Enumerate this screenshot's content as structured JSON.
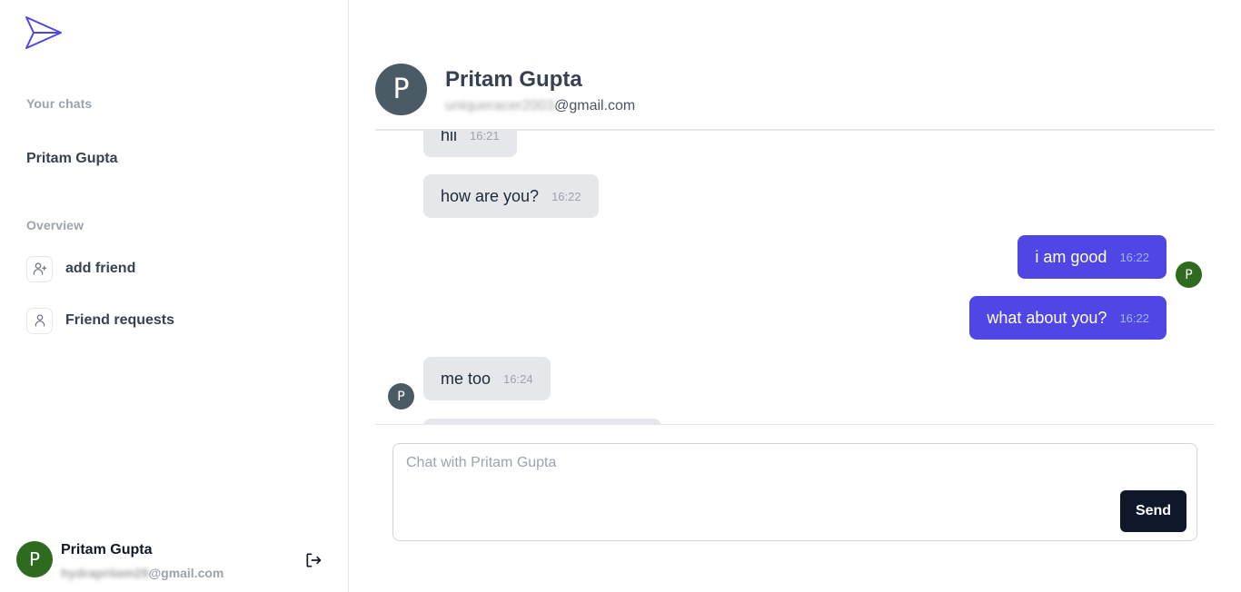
{
  "app": {
    "logo_icon": "paper-plane-icon",
    "accent_color": "#4f46e5"
  },
  "sidebar": {
    "chats_label": "Your chats",
    "chats": [
      {
        "name": "Pritam Gupta"
      }
    ],
    "overview_label": "Overview",
    "overview_items": [
      {
        "label": "add friend",
        "icon": "user-plus-icon"
      },
      {
        "label": "Friend requests",
        "icon": "user-icon"
      }
    ],
    "profile": {
      "initial": "P",
      "name": "Pritam Gupta",
      "email_hidden": "hydrapritam29",
      "email_domain": "@gmail.com",
      "avatar_color": "#2f6b1f",
      "logout_icon": "sign-out-icon"
    }
  },
  "chat": {
    "partner": {
      "initial": "P",
      "name": "Pritam Gupta",
      "email_hidden": "uniqueracer2003",
      "email_domain": "@gmail.com",
      "avatar_color": "#4b5b66"
    },
    "messages": [
      {
        "text": "hii",
        "time": "16:21",
        "direction": "in"
      },
      {
        "text": "how are you?",
        "time": "16:22",
        "direction": "in"
      },
      {
        "text": "i am good",
        "time": "16:22",
        "direction": "out"
      },
      {
        "text": "what about you?",
        "time": "16:22",
        "direction": "out"
      },
      {
        "text": "me too",
        "time": "16:24",
        "direction": "in"
      }
    ],
    "avatar_initial": "P",
    "composer": {
      "placeholder": "Chat with Pritam Gupta",
      "value": "",
      "send_label": "Send"
    }
  }
}
